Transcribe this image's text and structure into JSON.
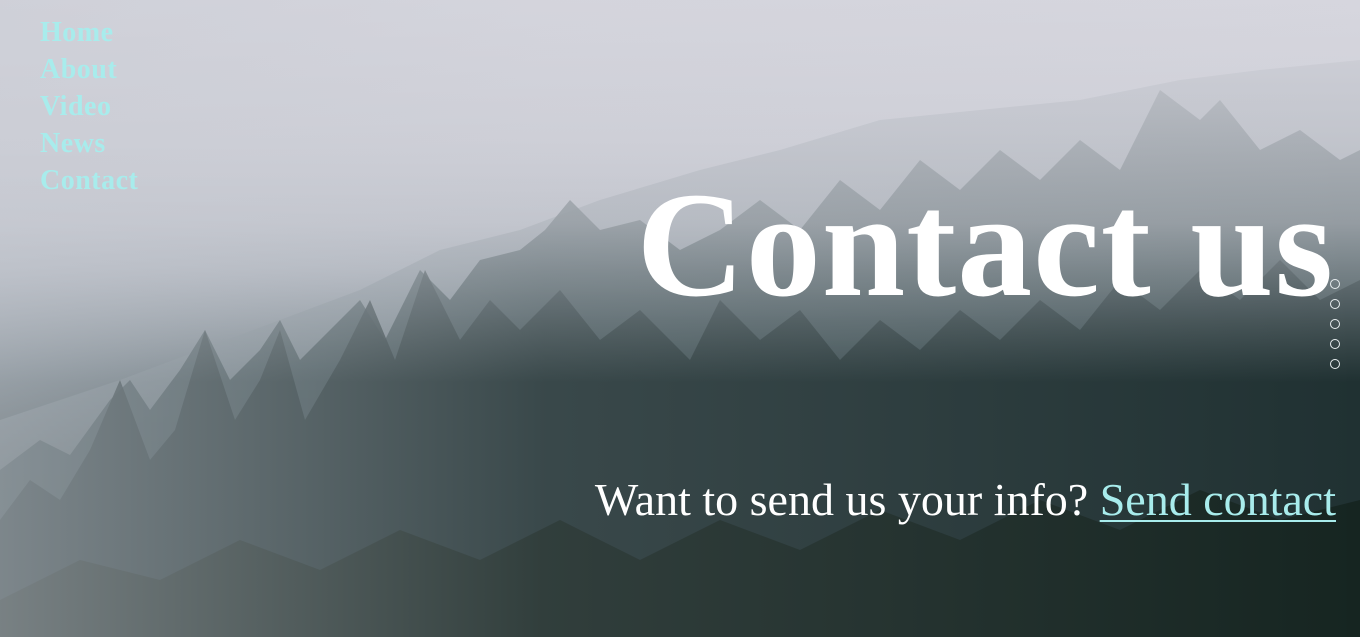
{
  "nav": {
    "items": [
      {
        "label": "Home"
      },
      {
        "label": "About"
      },
      {
        "label": "Video"
      },
      {
        "label": "News"
      },
      {
        "label": "Contact"
      }
    ]
  },
  "hero": {
    "title": "Contact us",
    "subtitle_text": "Want to send us your info? ",
    "subtitle_link": "Send contact"
  },
  "pagination": {
    "dot_count": 5
  },
  "colors": {
    "nav_link": "#a8ecec",
    "heading": "#ffffff",
    "link": "#a8ecec"
  }
}
